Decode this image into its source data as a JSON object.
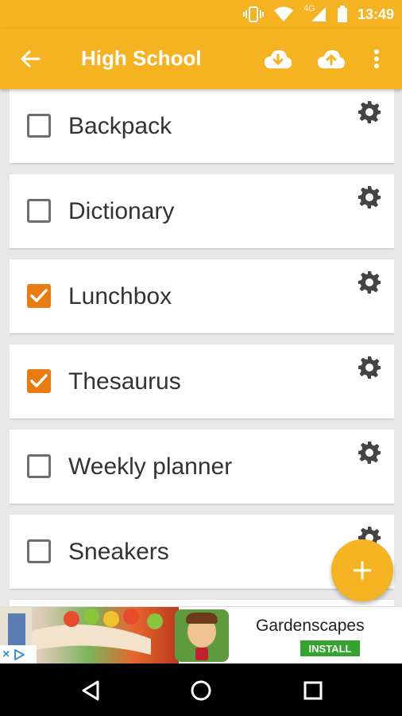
{
  "status_bar": {
    "time": "13:49",
    "network_label": "4G"
  },
  "app_bar": {
    "title": "High School",
    "back_icon": "arrow-back-icon",
    "download_icon": "cloud-download-icon",
    "upload_icon": "cloud-upload-icon",
    "menu_icon": "more-vert-icon"
  },
  "items": [
    {
      "label": "Backpack",
      "checked": false
    },
    {
      "label": "Dictionary",
      "checked": false
    },
    {
      "label": "Lunchbox",
      "checked": true
    },
    {
      "label": "Thesaurus",
      "checked": true
    },
    {
      "label": "Weekly planner",
      "checked": false
    },
    {
      "label": "Sneakers",
      "checked": false
    }
  ],
  "fab": {
    "icon": "plus-icon"
  },
  "ad": {
    "title": "Gardenscapes",
    "install_label": "INSTALL"
  },
  "colors": {
    "accent": "#f5b321",
    "checkbox_checked": "#ea7b10",
    "install_green": "#32a32c"
  }
}
